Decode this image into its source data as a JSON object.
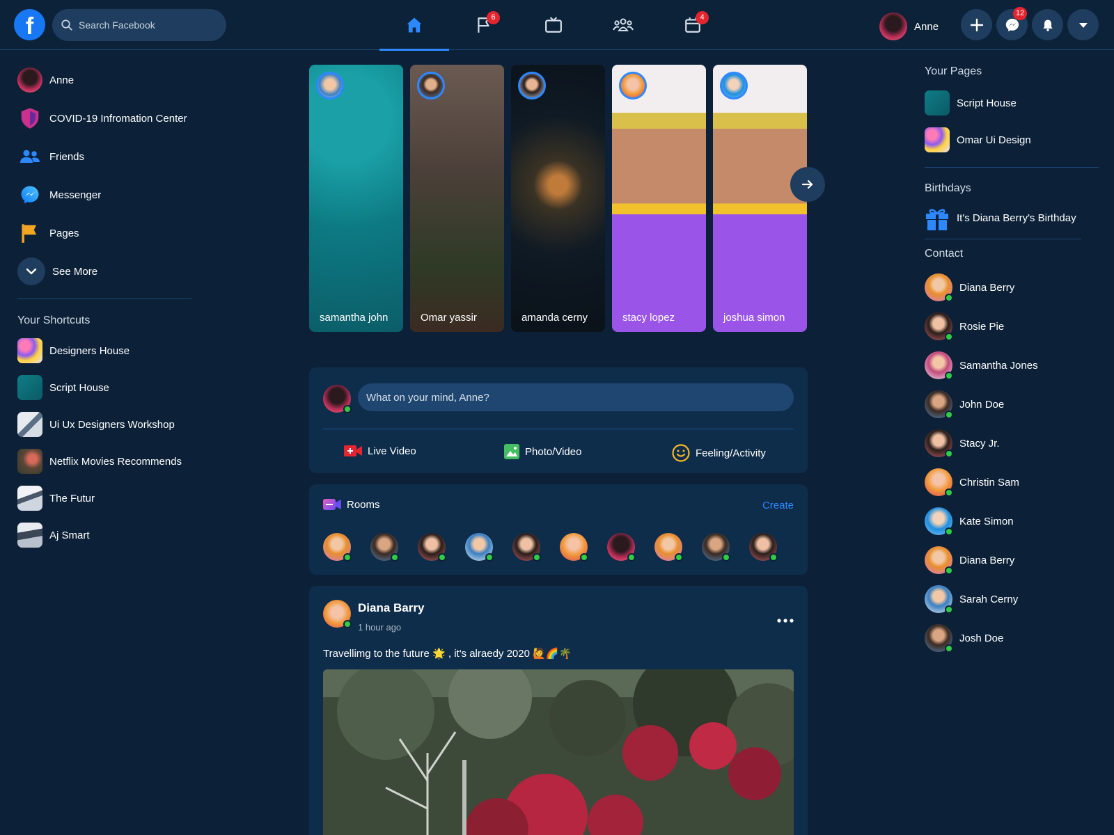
{
  "header": {
    "logo_letter": "f",
    "search_placeholder": "Search Facebook",
    "nav_tabs": [
      {
        "icon": "home-icon",
        "active": true,
        "badge": ""
      },
      {
        "icon": "flag-icon",
        "active": false,
        "badge": "6"
      },
      {
        "icon": "tv-icon",
        "active": false,
        "badge": ""
      },
      {
        "icon": "groups-icon",
        "active": false,
        "badge": ""
      },
      {
        "icon": "calendar-icon",
        "active": false,
        "badge": "4"
      }
    ],
    "profile_name": "Anne",
    "messenger_badge": "12"
  },
  "left": {
    "items": [
      {
        "label": "Anne",
        "icon": "avatar"
      },
      {
        "label": "COVID-19 Infromation Center",
        "icon": "shield-icon"
      },
      {
        "label": "Friends",
        "icon": "friends-icon"
      },
      {
        "label": "Messenger",
        "icon": "messenger-icon"
      },
      {
        "label": "Pages",
        "icon": "flag-icon"
      },
      {
        "label": "See More",
        "icon": "chevron-down-icon"
      }
    ],
    "shortcuts_title": "Your Shortcuts",
    "shortcuts": [
      {
        "label": "Designers House"
      },
      {
        "label": "Script House"
      },
      {
        "label": "Ui Ux Designers Workshop"
      },
      {
        "label": "Netflix Movies Recommends"
      },
      {
        "label": "The Futur"
      },
      {
        "label": "Aj Smart"
      }
    ]
  },
  "stories": [
    {
      "name": "samantha john"
    },
    {
      "name": "Omar yassir"
    },
    {
      "name": "amanda cerny"
    },
    {
      "name": "stacy lopez"
    },
    {
      "name": "joshua simon"
    }
  ],
  "composer": {
    "placeholder": "What on your mind, Anne?",
    "actions": [
      {
        "label": "Live Video",
        "icon": "live-video-icon",
        "color": "#e4252f"
      },
      {
        "label": "Photo/Video",
        "icon": "photo-icon",
        "color": "#45bd62"
      },
      {
        "label": "Feeling/Activity",
        "icon": "smile-icon",
        "color": "#f7b928"
      }
    ]
  },
  "rooms": {
    "title": "Rooms",
    "create_label": "Create"
  },
  "post": {
    "author": "Diana Barry",
    "time": "1 hour ago",
    "text": "Travellimg to the future 🌟 , it's alraedy 2020 🙋🌈🌴"
  },
  "right": {
    "pages_title": "Your Pages",
    "pages": [
      {
        "label": "Script House"
      },
      {
        "label": "Omar Ui Design"
      }
    ],
    "birthdays_title": "Birthdays",
    "birthday_text": "It's Diana Berry's Birthday",
    "contacts_title": "Contact",
    "contacts": [
      {
        "name": "Diana Berry"
      },
      {
        "name": "Rosie Pie"
      },
      {
        "name": "Samantha Jones"
      },
      {
        "name": "John Doe"
      },
      {
        "name": "Stacy Jr."
      },
      {
        "name": "Christin Sam"
      },
      {
        "name": "Kate Simon"
      },
      {
        "name": "Diana Berry"
      },
      {
        "name": "Sarah Cerny"
      },
      {
        "name": "Josh Doe"
      }
    ]
  },
  "colors": {
    "background": "#0c2138",
    "card": "#0e2d4b",
    "accent": "#2d88ff",
    "badge": "#e4252f",
    "online": "#31cc46"
  }
}
